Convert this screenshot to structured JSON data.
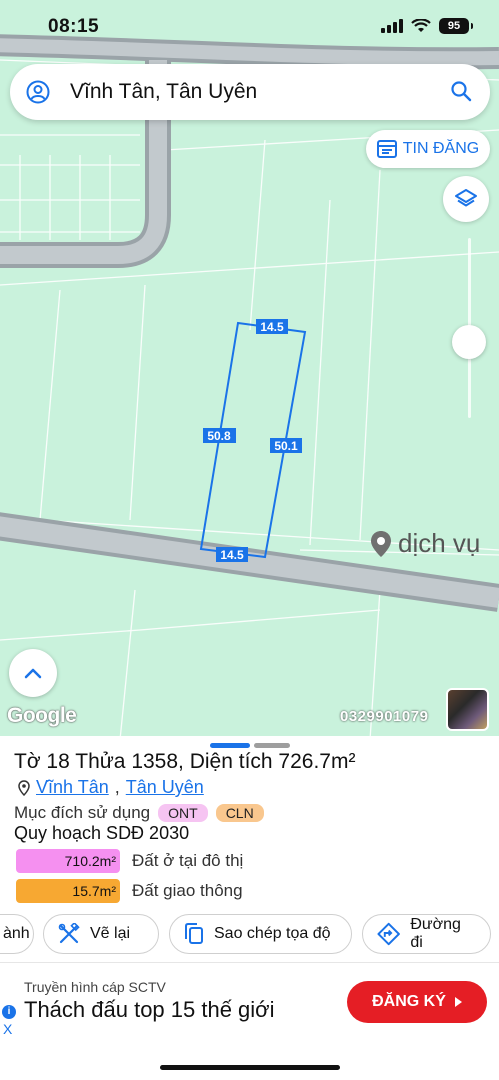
{
  "status_bar": {
    "time": "08:15",
    "battery": "95"
  },
  "search": {
    "text": "Vĩnh Tân, Tân Uyên"
  },
  "map": {
    "tin_dang_label": "TIN ĐĂNG",
    "dimensions": {
      "top": "14.5",
      "left": "50.8",
      "right": "50.1",
      "bottom": "14.5"
    },
    "poi_label": "dịch vụ",
    "google_logo": "Google",
    "phone_overlay": "0329901079"
  },
  "parcel": {
    "title": "Tờ 18 Thửa 1358, Diện tích 726.7m²",
    "location_1": "Vĩnh Tân",
    "location_sep": ",",
    "location_2": "Tân Uyên",
    "purpose_label": "Mục đích sử dụng",
    "tags": [
      "ONT",
      "CLN"
    ],
    "plan_title": "Quy hoạch SDĐ 2030",
    "plan_items": [
      {
        "area": "710.2m²",
        "label": "Đất ở tại đô thị",
        "color": "#f590f0"
      },
      {
        "area": "15.7m²",
        "label": "Đất giao thông",
        "color": "#f7a832"
      }
    ]
  },
  "actions": {
    "partial_label": "ành",
    "redraw_label": "Vẽ lại",
    "copy_coords_label": "Sao chép tọa độ",
    "route_label": "Đường đi"
  },
  "ad": {
    "subtitle": "Truyền hình cáp SCTV",
    "title": "Thách đấu top 15 thế giới",
    "button_label": "ĐĂNG KÝ",
    "close_label": "X"
  },
  "colors": {
    "map_bg": "#c9f2dc",
    "road": "#9aa3a8",
    "accent": "#1a73e8",
    "ad_button": "#e51e25"
  }
}
